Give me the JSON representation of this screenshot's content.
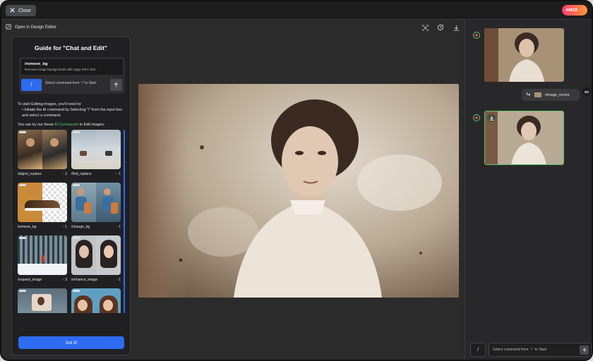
{
  "topbar": {
    "close_label": "Close",
    "credits": "44019"
  },
  "toolbar": {
    "open_editor_label": "Open in Design Editor"
  },
  "guide": {
    "title": "Guide for \"Chat and Edit\"",
    "preview": {
      "command": "/remove_bg",
      "description": "Remove image backgrounds with Appy Pie's Tool"
    },
    "slash_label": "/",
    "input_placeholder": "Select command from ' /' to Start",
    "intro": "To start Editing images, you'll need to:",
    "bullet": "Initiate the AI command by Selecting \"/\" from the input box and select a command.",
    "try_prefix": "You can try our these",
    "try_link": "AI Commands",
    "try_suffix": "to Edit images:",
    "commands": [
      {
        "name": "/object_replace",
        "cost": "- 2"
      },
      {
        "name": "/find_replace",
        "cost": "- 1"
      },
      {
        "name": "/remove_bg",
        "cost": "- 1"
      },
      {
        "name": "/change_bg",
        "cost": "- 1"
      },
      {
        "name": "/expand_image",
        "cost": "- 3"
      },
      {
        "name": "/enhance_image",
        "cost": "- 1"
      },
      {
        "name": "",
        "cost": ""
      },
      {
        "name": "",
        "cost": ""
      }
    ],
    "got_it_label": "Got it!"
  },
  "chat": {
    "user_message": "/image_revive",
    "user_initials": "SU",
    "input_slash": "/",
    "input_placeholder": "Select command from ' / ' to Start"
  },
  "colors": {
    "accent": "#2d6bf0",
    "link": "#5fc46b",
    "result_border": "#5fc46b"
  }
}
